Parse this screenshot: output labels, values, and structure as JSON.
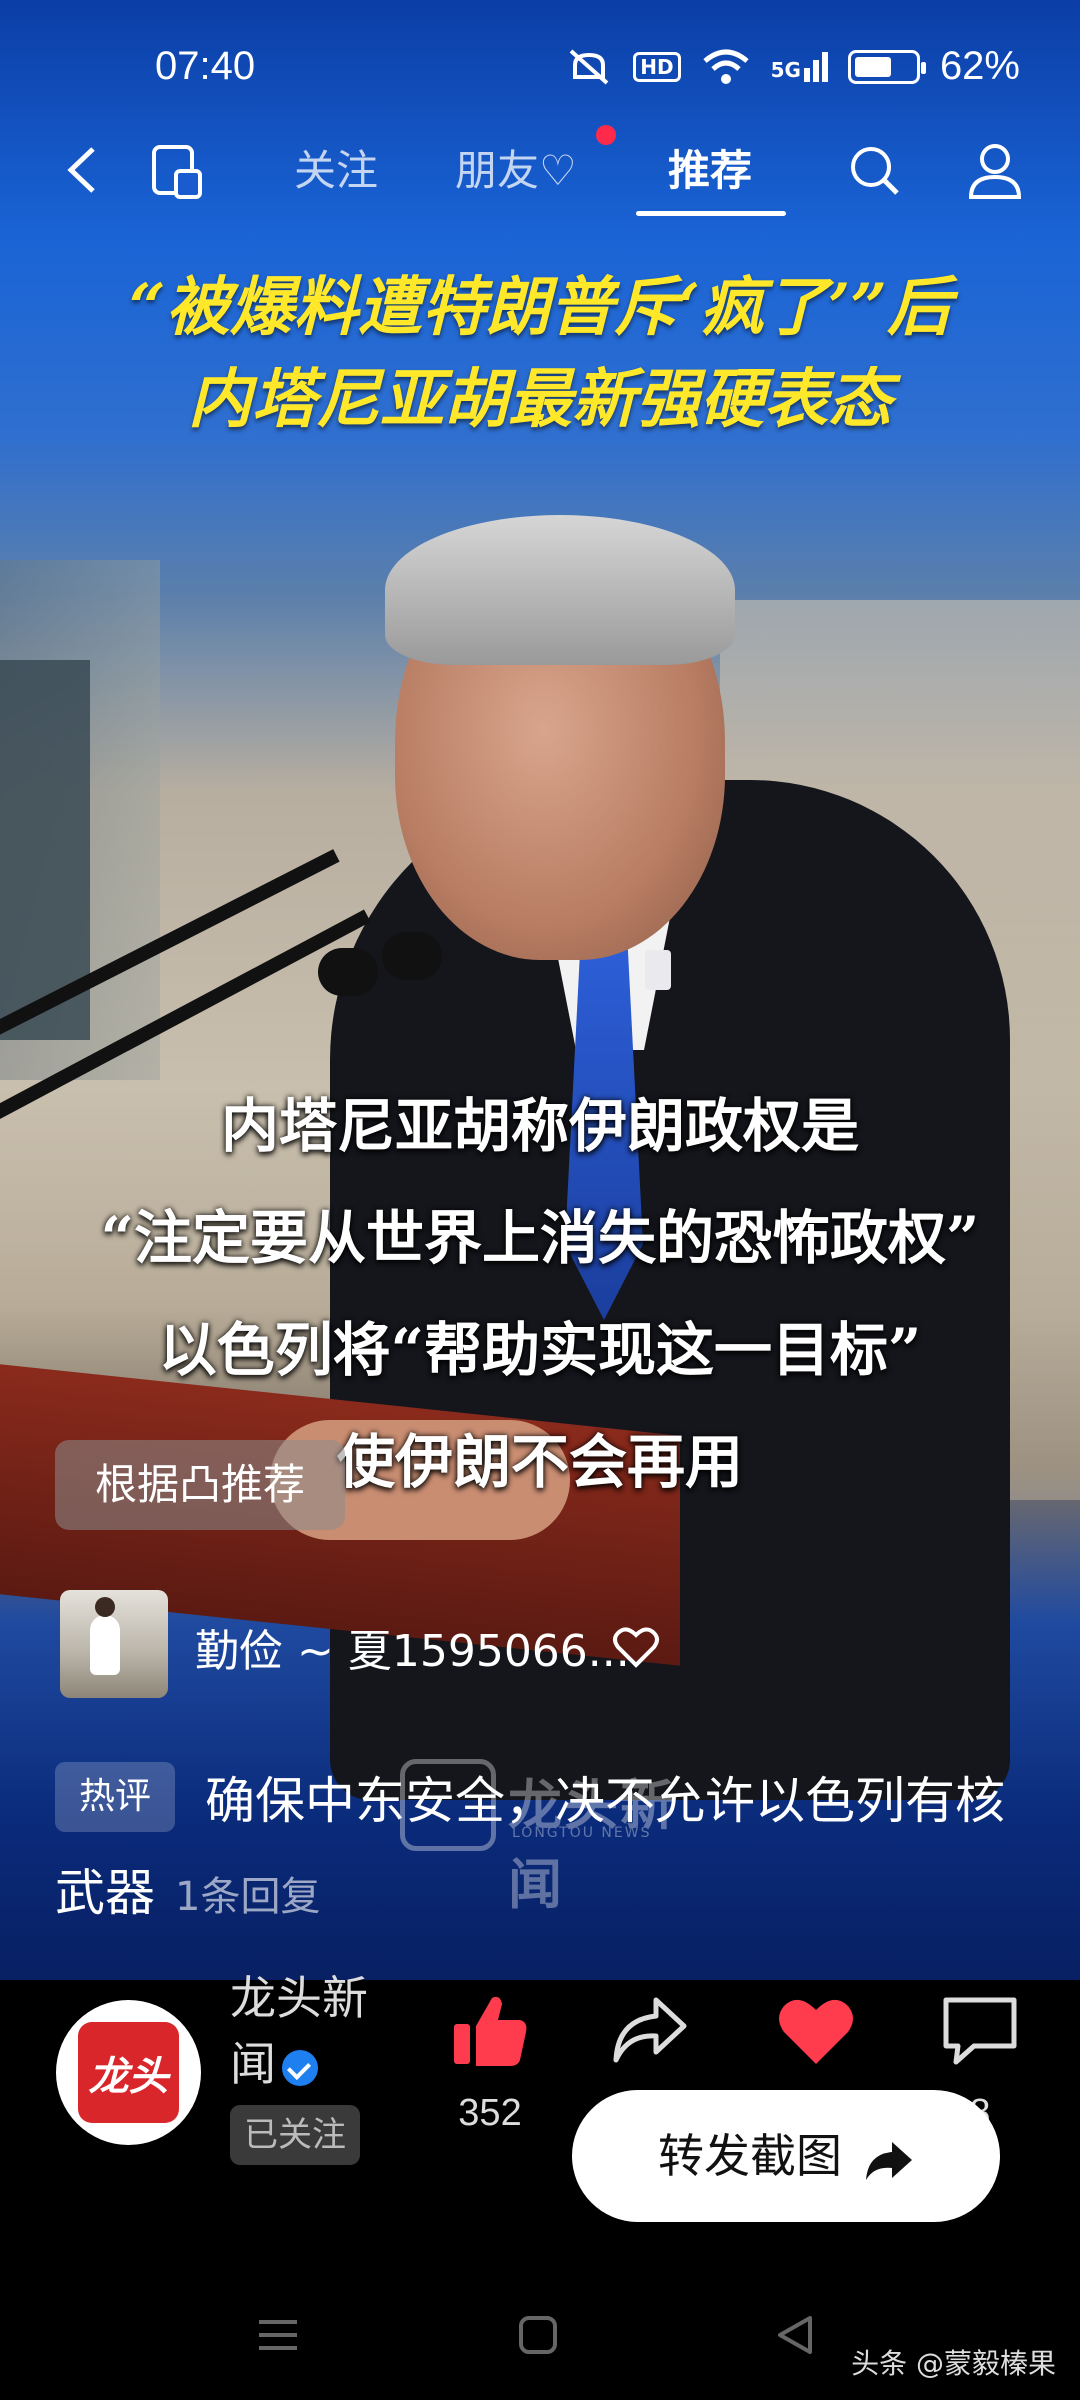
{
  "status_bar": {
    "time": "07:40",
    "hd": "HD",
    "network": "5G",
    "battery_level": 0.62,
    "battery_text": "62%"
  },
  "nav": {
    "tabs": [
      {
        "label": "关注",
        "active": false
      },
      {
        "label": "朋友♡",
        "active": false,
        "badge": true
      },
      {
        "label": "推荐",
        "active": true
      }
    ]
  },
  "headline": {
    "line1": "“被爆料遭特朗普斥‘疯了’”后",
    "line2": "内塔尼亚胡最新强硬表态"
  },
  "subtitle": {
    "line1": "内塔尼亚胡称伊朗政权是",
    "line2": "“注定要从世界上消失的恐怖政权”",
    "line3": "以色列将“帮助实现这一目标”",
    "line4": "使伊朗不会再用"
  },
  "recommend_tag": "根据凸推荐",
  "friend": {
    "name": "勤俭 ~ 夏1595066..."
  },
  "hot_comment": {
    "tag": "热评",
    "text": "确保中东安全，决不允许以色列有核武器",
    "replies": "1条回复"
  },
  "watermark": {
    "text": "龙头新闻",
    "sub": "LONGTOU NEWS"
  },
  "publisher": {
    "name": "龙头新闻",
    "logo_text": "龙头",
    "follow_state": "已关注"
  },
  "actions": {
    "likes": "352",
    "comments": "8"
  },
  "forward_button": "转发截图",
  "credit": "头条 @蒙毅榛果",
  "colors": {
    "headline": "#ffe82a",
    "like": "#ff3b4e",
    "accent_blue": "#1e7ff0"
  }
}
